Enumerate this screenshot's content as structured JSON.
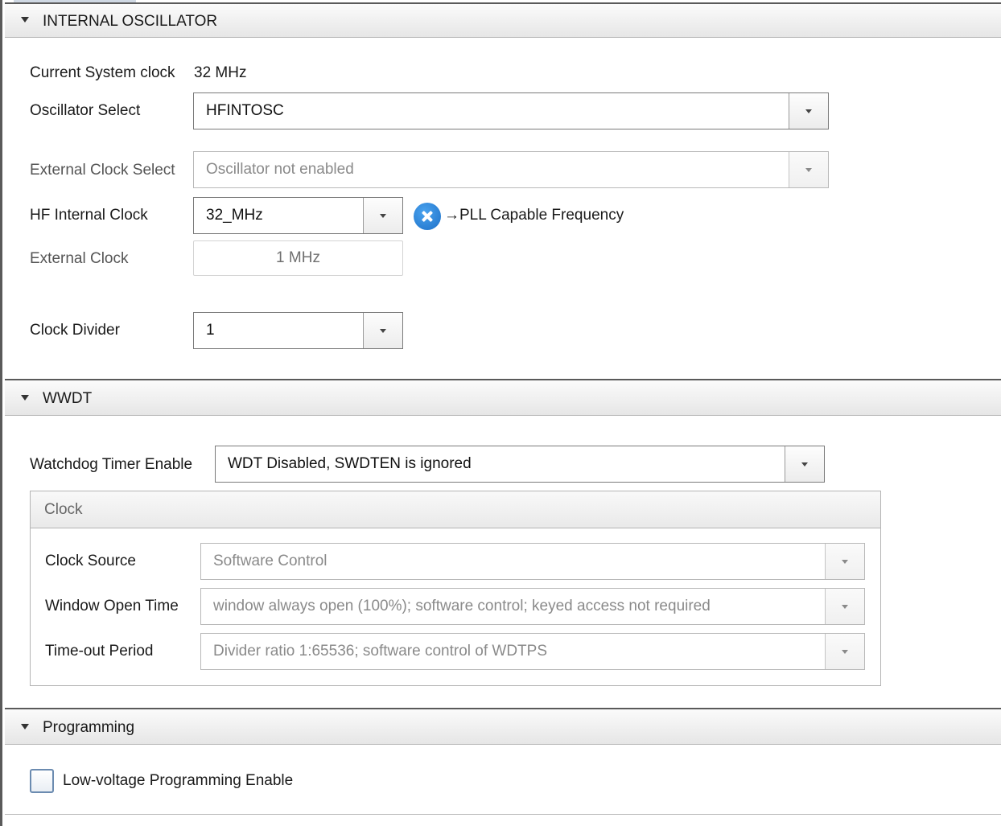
{
  "sections": {
    "oscillator": {
      "title": "INTERNAL OSCILLATOR",
      "current_clock_label": "Current System clock",
      "current_clock_value": "32 MHz",
      "oscillator_select": {
        "label": "Oscillator Select",
        "value": "HFINTOSC"
      },
      "external_clock_select": {
        "label": "External Clock Select",
        "value": "Oscillator not enabled"
      },
      "hf_internal_clock": {
        "label": "HF Internal Clock",
        "value": "32_MHz",
        "note": "→PLL Capable Frequency"
      },
      "external_clock": {
        "label": "External Clock",
        "value": "1 MHz"
      },
      "clock_divider": {
        "label": "Clock Divider",
        "value": "1"
      }
    },
    "wwdt": {
      "title": "WWDT",
      "watchdog_enable": {
        "label": "Watchdog Timer Enable",
        "value": "WDT Disabled, SWDTEN is ignored"
      },
      "clock_group": {
        "title": "Clock",
        "clock_source": {
          "label": "Clock Source",
          "value": "Software Control"
        },
        "window_open_time": {
          "label": "Window Open Time",
          "value": "window always open (100%); software control; keyed access not required"
        },
        "timeout_period": {
          "label": "Time-out Period",
          "value": "Divider ratio 1:65536; software control of WDTPS"
        }
      }
    },
    "programming": {
      "title": "Programming",
      "lvp_label": "Low-voltage Programming Enable",
      "lvp_checked": false
    }
  },
  "icons": {
    "collapse": "triangle-down-icon",
    "dropdown": "chevron-down-icon",
    "error": "x-circle-icon"
  },
  "colors": {
    "error_icon": "#1c6fc7",
    "header_bg": "#e6e6e6",
    "disabled_text": "#8a8a8a"
  }
}
